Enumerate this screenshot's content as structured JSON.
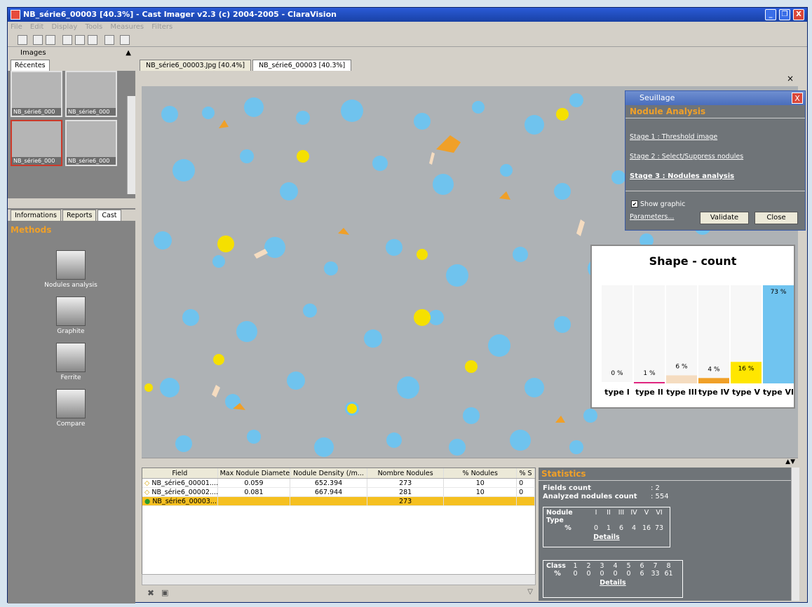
{
  "window": {
    "title": "NB_série6_00003 [40.3%] - Cast Imager v2.3 (c) 2004-2005 - ClaraVision",
    "min": "_",
    "max": "❐",
    "close": "X"
  },
  "menu": [
    "File",
    "Edit",
    "Display",
    "Tools",
    "Measures",
    "Filters"
  ],
  "left": {
    "images_label": "Images",
    "recent_tab": "Récentes",
    "thumbs": [
      "NB_série6_000",
      "NB_série6_000",
      "NB_série6_000",
      "NB_série6_000"
    ],
    "bottom_tabs": [
      "Informations",
      "Reports",
      "Cast"
    ],
    "methods_title": "Methods",
    "methods": [
      "Nodules analysis",
      "Graphite",
      "Ferrite",
      "Compare"
    ]
  },
  "image_tabs": [
    "NB_série6_00003.Jpg [40.4%]",
    "NB_série6_00003 [40.3%]"
  ],
  "seuillage": {
    "title": "Seuillage",
    "close": "X",
    "heading": "Nodule Analysis",
    "stage1": "Stage 1 : Threshold image",
    "stage2": "Stage 2 : Select/Suppress nodules",
    "stage3": "Stage 3 : Nodules analysis",
    "show_graphic": "Show graphic",
    "parameters": "Parameters...",
    "validate": "Validate",
    "close_btn": "Close"
  },
  "chart_data": {
    "type": "bar",
    "title": "Shape - count",
    "categories": [
      "type I",
      "type II",
      "type III",
      "type IV",
      "type V",
      "type VI"
    ],
    "values": [
      0,
      1,
      6,
      4,
      16,
      73
    ],
    "value_labels": [
      "0 %",
      "1 %",
      "6 %",
      "4 %",
      "16 %",
      "73 %"
    ],
    "colors": [
      "#ffffff",
      "#e0257f",
      "#f5dcc0",
      "#f0a028",
      "#ffe600",
      "#70c4f0"
    ],
    "ylim": [
      0,
      73
    ]
  },
  "table": {
    "headers": [
      "Field",
      "Max Nodule Diameter",
      "Nodule Density (/m...",
      "Nombre Nodules",
      "% Nodules",
      "% S"
    ],
    "rows": [
      [
        "NB_série6_00001....",
        "0.059",
        "652.394",
        "273",
        "10",
        "0"
      ],
      [
        "NB_série6_00002....",
        "0.081",
        "667.944",
        "281",
        "10",
        "0"
      ],
      [
        "NB_série6_00003....",
        "",
        "",
        "273",
        "",
        ""
      ]
    ]
  },
  "stats": {
    "title": "Statistics",
    "fields_count_label": "Fields count",
    "fields_count": ": 2",
    "analyzed_label": "Analyzed nodules count",
    "analyzed": ": 554",
    "nodule_type_label": "Nodule Type",
    "nodule_types": [
      "I",
      "II",
      "III",
      "IV",
      "V",
      "VI"
    ],
    "pct_symbol": "%",
    "nodule_pcts": [
      "0",
      "1",
      "6",
      "4",
      "16",
      "73"
    ],
    "details": "Details",
    "class_label": "Class",
    "classes": [
      "1",
      "2",
      "3",
      "4",
      "5",
      "6",
      "7",
      "8"
    ],
    "class_pcts": [
      "0",
      "0",
      "0",
      "0",
      "0",
      "6",
      "33",
      "61"
    ],
    "details2": "Details"
  },
  "viewer_close": "×"
}
